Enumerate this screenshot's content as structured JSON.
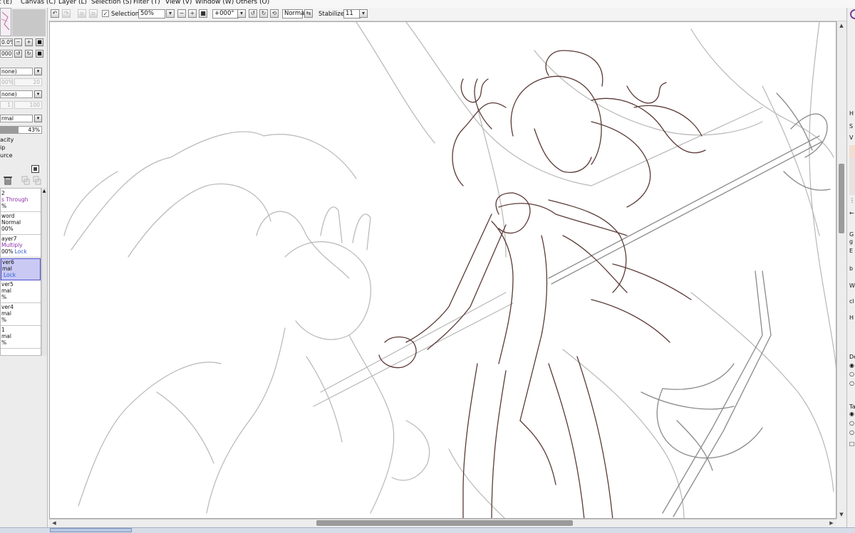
{
  "menu": {
    "items": [
      "t (E)",
      "Canvas (C)",
      "Layer (L)",
      "Selection (S)",
      "Filter (T)",
      "View (V)",
      "Window (W)",
      "Others (O)"
    ]
  },
  "toolbar": {
    "selection_label": "Selection",
    "selection_checked": true,
    "zoom_value": "50%",
    "rotation_value": "+000°",
    "blend_value": "Normal",
    "stabilizer_label": "Stabilizer",
    "stabilizer_value": "11"
  },
  "navigator": {
    "zoom_value": "0.0%",
    "angle_value": "000$"
  },
  "left_panel": {
    "texture_value": "none)",
    "texture_scale": "00%",
    "texture_strength": "20",
    "effect_value": "none)",
    "effect_width": "1",
    "effect_strength": "100",
    "blend_mode": "rmal",
    "opacity_value": "43%",
    "options": [
      "acity",
      "ip",
      "urce"
    ]
  },
  "layers": [
    {
      "name": "2",
      "mode": "s Through",
      "extra": "%",
      "mode_color": "purple",
      "lock": "",
      "selected": false
    },
    {
      "name": "word",
      "mode": "Normal",
      "extra": "00%",
      "mode_color": "black",
      "lock": "",
      "selected": false
    },
    {
      "name": "ayer7",
      "mode": "Multiply",
      "extra": "00%",
      "mode_color": "purple",
      "lock": "Lock",
      "selected": false
    },
    {
      "name": "ver6",
      "mode": "mal",
      "extra": "",
      "mode_color": "black",
      "lock": "Lock",
      "selected": true
    },
    {
      "name": "ver5",
      "mode": "mal",
      "extra": "%",
      "mode_color": "black",
      "lock": "",
      "selected": false
    },
    {
      "name": "ver4",
      "mode": "mal",
      "extra": "%",
      "mode_color": "black",
      "lock": "",
      "selected": false
    },
    {
      "name": "1",
      "mode": "mal",
      "extra": "%",
      "mode_color": "black",
      "lock": "",
      "selected": false
    }
  ],
  "right_panel": {
    "labels": [
      "H",
      "S",
      "V",
      "G",
      "g",
      "E",
      "b",
      "W",
      "cl",
      "H",
      "De",
      "Ta"
    ]
  },
  "colors": {
    "selected_layer_bg": "#c9c9f4",
    "selected_layer_border": "#4b4bd0",
    "purple_mode": "#8b2fa8",
    "lock_blue": "#2a5bd0"
  }
}
